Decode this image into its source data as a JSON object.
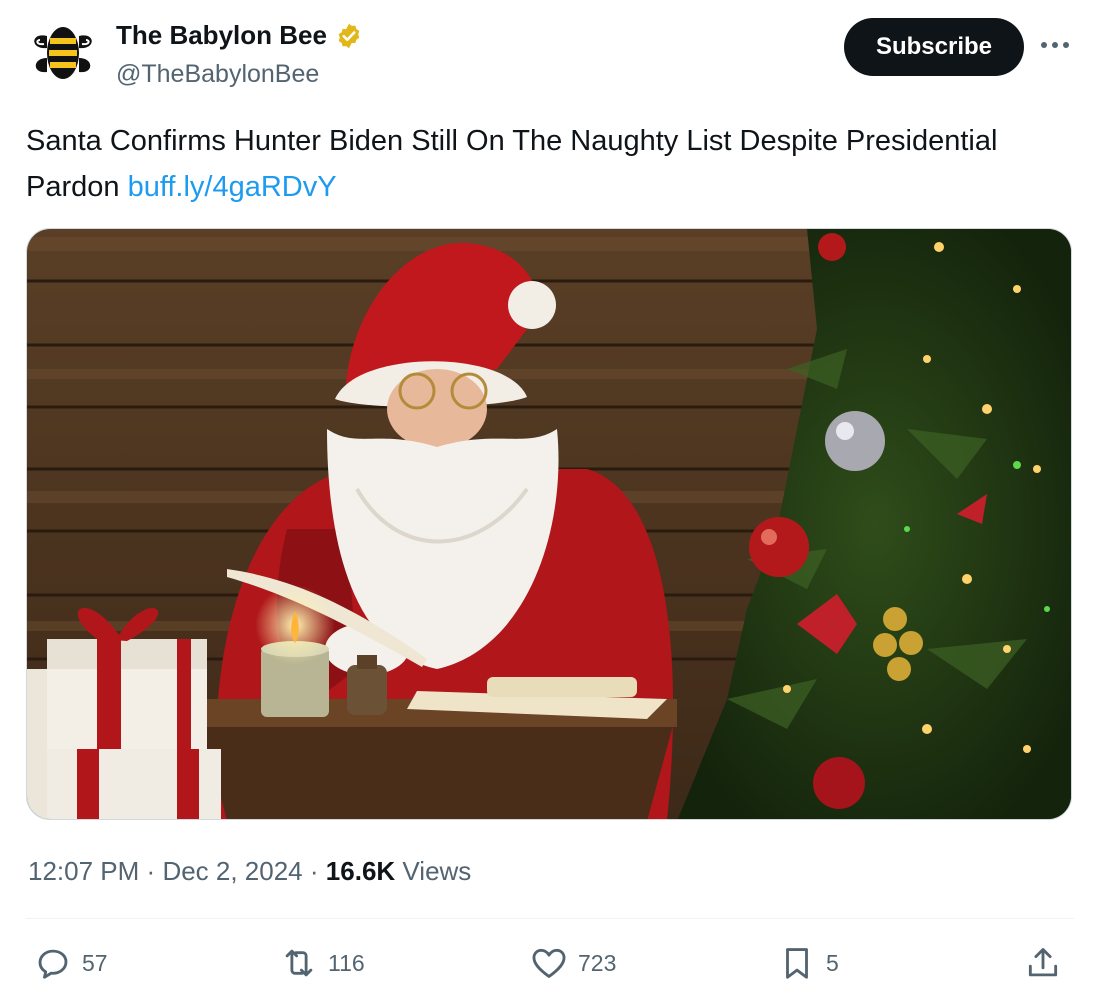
{
  "author": {
    "display_name": "The Babylon Bee",
    "handle": "@TheBabylonBee",
    "verified_icon": "verified-badge-gold",
    "avatar_icon": "bee-logo"
  },
  "subscribe_label": "Subscribe",
  "more_icon": "more-horizontal-icon",
  "tweet": {
    "text": "Santa Confirms Hunter Biden Still On The Naughty List Despite Presidential Pardon",
    "link": "buff.ly/4gaRDvY"
  },
  "media": {
    "description_icon": "santa-photo"
  },
  "meta": {
    "time": "12:07 PM",
    "separator": "·",
    "date": "Dec 2, 2024",
    "views_count": "16.6K",
    "views_label": "Views"
  },
  "actions": {
    "replies": "57",
    "reposts": "116",
    "likes": "723",
    "bookmarks": "5"
  },
  "colors": {
    "link": "#1d9bf0",
    "secondary_text": "#536471",
    "primary_text": "#0f1419",
    "verified_gold": "#e2b719"
  }
}
